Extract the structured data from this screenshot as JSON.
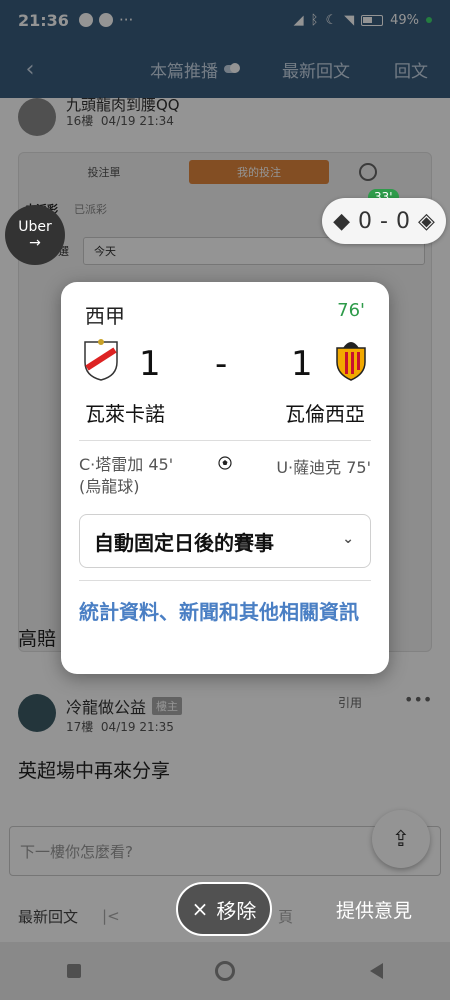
{
  "statusbar": {
    "time": "21:36",
    "battery": "49%"
  },
  "appbar": {
    "back_icon": "chevron-left-icon",
    "tabs": [
      {
        "label": "本篇推播"
      },
      {
        "label": "最新回文"
      },
      {
        "label": "回文"
      }
    ]
  },
  "post_above": {
    "name": "九頭龍肉到腰QQ",
    "floor": "16樓",
    "datetime": "04/19 21:34"
  },
  "bet_panel": {
    "tab_slip": "投注單",
    "tab_my": "我的投注",
    "filter_tabs": [
      "未派彩",
      "已派彩"
    ],
    "date_label": "日期篩選",
    "date_value": "今天"
  },
  "score_bubble": {
    "minute": "33'",
    "home": "0",
    "sep": "-",
    "away": "0"
  },
  "uber": {
    "label": "Uber",
    "arrow": "→"
  },
  "post_text_truncated": "高賠",
  "reply": {
    "name": "冷龍做公益",
    "badge": "樓主",
    "floor": "17樓",
    "datetime": "04/19 21:35",
    "quote": "引用",
    "more": "•••",
    "text": "英超場中再來分享"
  },
  "reply_input": {
    "placeholder": "下一樓你怎麼看?"
  },
  "bottombar": {
    "latest": "最新回文",
    "pager": "|<",
    "page": "頁"
  },
  "overlay_actions": {
    "remove_label": "移除",
    "remove_icon": "×",
    "feedback": "提供意見"
  },
  "match_card": {
    "league": "西甲",
    "minute": "76'",
    "home_team": "瓦萊卡諾",
    "away_team": "瓦倫西亞",
    "home_score": "1",
    "away_score": "1",
    "dash": "-",
    "goal_home": "C·塔雷加 45'",
    "goal_home_note": "(烏龍球)",
    "goal_away": "U·薩迪克 75'",
    "follow_option": "自動固定日後的賽事",
    "more_info": "統計資料、新聞和其他相關資訊",
    "colors": {
      "minute": "#2e9b4a",
      "link": "#4a7fc4"
    }
  }
}
